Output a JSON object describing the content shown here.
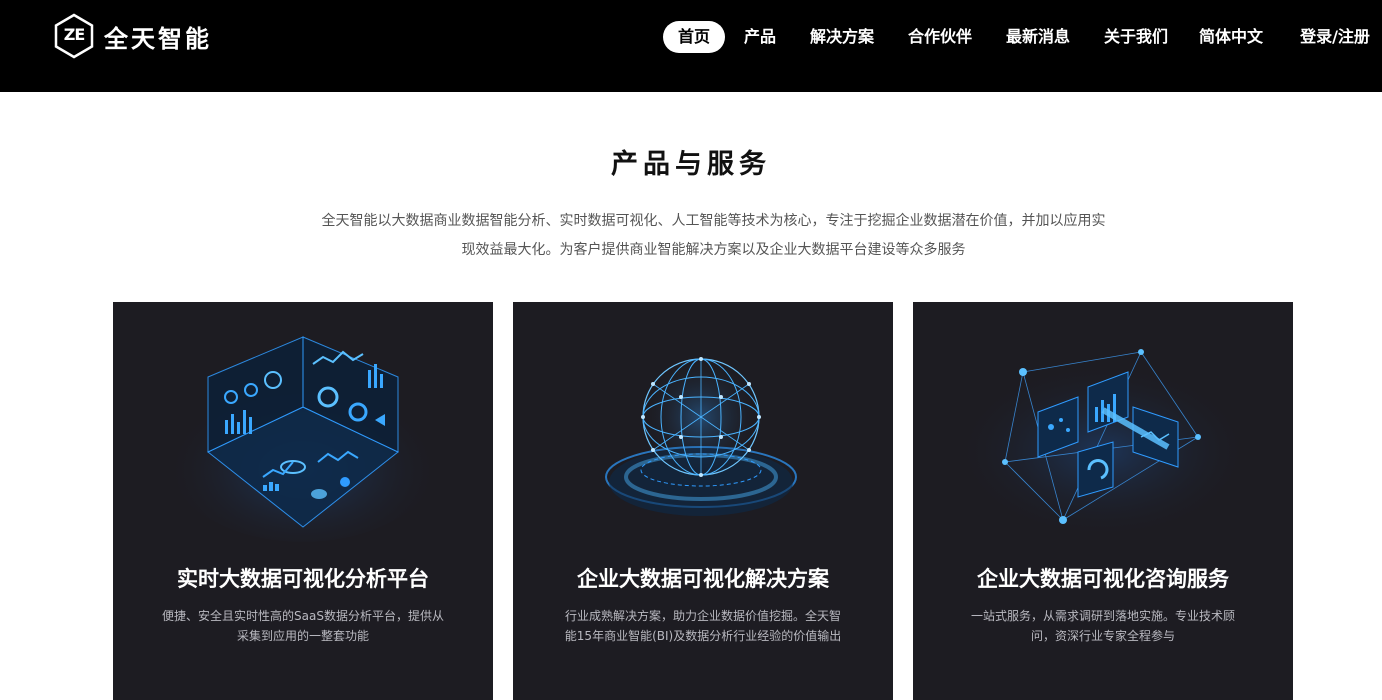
{
  "header": {
    "logo_mark": "ZE",
    "brand_name": "全天智能",
    "nav": [
      {
        "label": "首页",
        "active": true
      },
      {
        "label": "产品",
        "active": false
      },
      {
        "label": "解决方案",
        "active": false
      },
      {
        "label": "合作伙伴",
        "active": false
      },
      {
        "label": "最新消息",
        "active": false
      },
      {
        "label": "关于我们",
        "active": false
      },
      {
        "label": "简体中文",
        "active": false
      },
      {
        "label": "登录/注册",
        "active": false
      }
    ]
  },
  "section": {
    "title": "产品与服务",
    "description_line1": "全天智能以大数据商业数据智能分析、实时数据可视化、人工智能等技术为核心，专注于挖掘企业数据潜在价值，并加以应用实",
    "description_line2": "现效益最大化。为客户提供商业智能解决方案以及企业大数据平台建设等众多服务"
  },
  "cards": [
    {
      "title": "实时大数据可视化分析平台",
      "desc_line1": "便捷、安全且实时性高的SaaS数据分析平台，提供从",
      "desc_line2": "采集到应用的一整套功能",
      "icon": "data-cube-icon"
    },
    {
      "title": "企业大数据可视化解决方案",
      "desc_line1": "行业成熟解决方案，助力企业数据价值挖掘。全天智",
      "desc_line2": "能15年商业智能(BI)及数据分析行业经验的价值输出",
      "icon": "network-globe-icon"
    },
    {
      "title": "企业大数据可视化咨询服务",
      "desc_line1": "一站式服务，从需求调研到落地实施。专业技术顾",
      "desc_line2": "问，资深行业专家全程参与",
      "icon": "dashboard-network-icon"
    }
  ],
  "colors": {
    "header_bg": "#000000",
    "card_bg": "#1d1c22",
    "accent_blue": "#2f9bff",
    "text_dark": "#111111",
    "text_muted": "#555555"
  }
}
